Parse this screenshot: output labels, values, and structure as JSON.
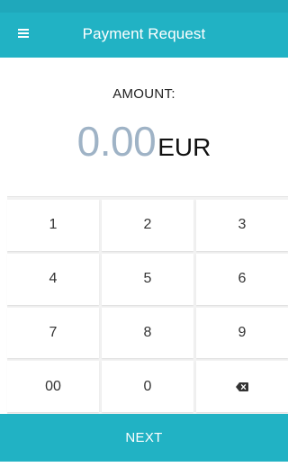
{
  "header": {
    "title": "Payment Request",
    "menu_icon": "hamburger-menu-icon",
    "background_color": "#21b2c4"
  },
  "amount": {
    "label": "AMOUNT:",
    "value": "0.00",
    "currency": "EUR",
    "value_color": "#9fb3c6"
  },
  "keypad": {
    "keys": [
      "1",
      "2",
      "3",
      "4",
      "5",
      "6",
      "7",
      "8",
      "9",
      "00",
      "0"
    ],
    "backspace_icon": "backspace-icon"
  },
  "footer": {
    "next_label": "NEXT",
    "background_color": "#21b2c4"
  }
}
